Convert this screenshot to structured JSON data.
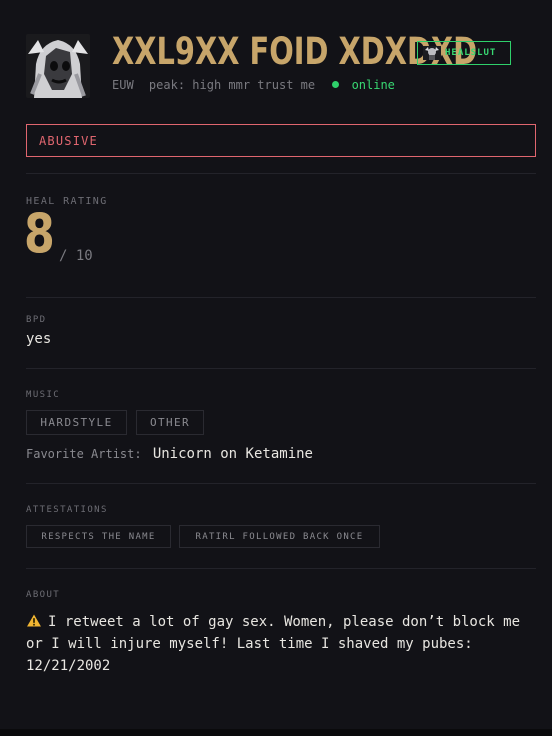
{
  "profile": {
    "name": "XXL9XX FOID XDXDXD",
    "badge_label": "HEALSLUT",
    "region": "EUW",
    "peak": "peak: high mmr trust me",
    "status": "online"
  },
  "flag": "ABUSIVE",
  "heal_rating": {
    "label": "HEAL RATING",
    "value": "8",
    "max": "/ 10"
  },
  "bpd": {
    "label": "BPD",
    "value": "yes"
  },
  "music": {
    "label": "MUSIC",
    "genres": [
      "HARDSTYLE",
      "OTHER"
    ],
    "favorite_label": "Favorite Artist:",
    "favorite_artist": "Unicorn on Ketamine"
  },
  "attestations": {
    "label": "ATTESTATIONS",
    "items": [
      "RESPECTS THE NAME",
      "RATIRL FOLLOWED BACK ONCE"
    ]
  },
  "about": {
    "label": "ABOUT",
    "icon": "warning-icon",
    "text": "I retweet a lot of gay sex. Women, please don’t block me or I will injure myself! Last time I shaved my pubes: 12/21/2002"
  },
  "colors": {
    "accent_gold": "#c7a56a",
    "online_green": "#2fd06b",
    "flag_red": "#e0666f",
    "background": "#121217"
  }
}
